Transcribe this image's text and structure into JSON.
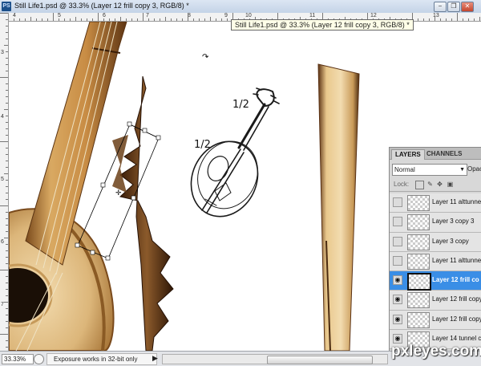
{
  "window": {
    "app_icon": "PS",
    "title": "Still Life1.psd @ 33.3% (Layer 12 frill copy 3, RGB/8) *",
    "buttons": [
      {
        "name": "minimize-button",
        "glyph": "−"
      },
      {
        "name": "restore-button",
        "glyph": "❐"
      },
      {
        "name": "close-button",
        "glyph": "✕"
      }
    ]
  },
  "rulers": {
    "top": [
      "4",
      "5",
      "6",
      "7",
      "8",
      "9",
      "10",
      "11",
      "12",
      "13"
    ],
    "left": [
      "3",
      "4",
      "5",
      "6",
      "7"
    ]
  },
  "tooltip": "Still Life1.psd @ 33.3% (Layer 12 frill copy 3, RGB/8) *",
  "canvas": {
    "sketch_labels": [
      "1/2",
      "1/2"
    ]
  },
  "status": {
    "zoom": "33.33%",
    "message": "Exposure works in 32-bit only",
    "arrow": "▶"
  },
  "layers_panel": {
    "tabs": [
      "LAYERS",
      "CHANNELS"
    ],
    "blend_mode": "Normal",
    "opacity_label": "Opac",
    "lock_label": "Lock:",
    "lock_icons": [
      "lock-transparent-icon",
      "lock-paint-icon",
      "lock-move-icon",
      "lock-all-icon"
    ],
    "layers": [
      {
        "name": "Layer 11 alttunnel",
        "visible": false,
        "selected": false
      },
      {
        "name": "Layer 3 copy 3",
        "visible": false,
        "selected": false
      },
      {
        "name": "Layer 3 copy",
        "visible": false,
        "selected": false
      },
      {
        "name": "Layer 11 alttunnel",
        "visible": false,
        "selected": false
      },
      {
        "name": "Layer 12 frill co",
        "visible": true,
        "selected": true
      },
      {
        "name": "Layer 12 frill copy",
        "visible": true,
        "selected": false
      },
      {
        "name": "Layer 12 frill copy",
        "visible": true,
        "selected": false
      },
      {
        "name": "Layer 14 tunnel c",
        "visible": true,
        "selected": false
      }
    ]
  },
  "watermark": "pxleyes.com",
  "colors": {
    "selection": "#3a8ee6",
    "wood_light": "#e0b97a",
    "wood_dark": "#5b3214"
  }
}
